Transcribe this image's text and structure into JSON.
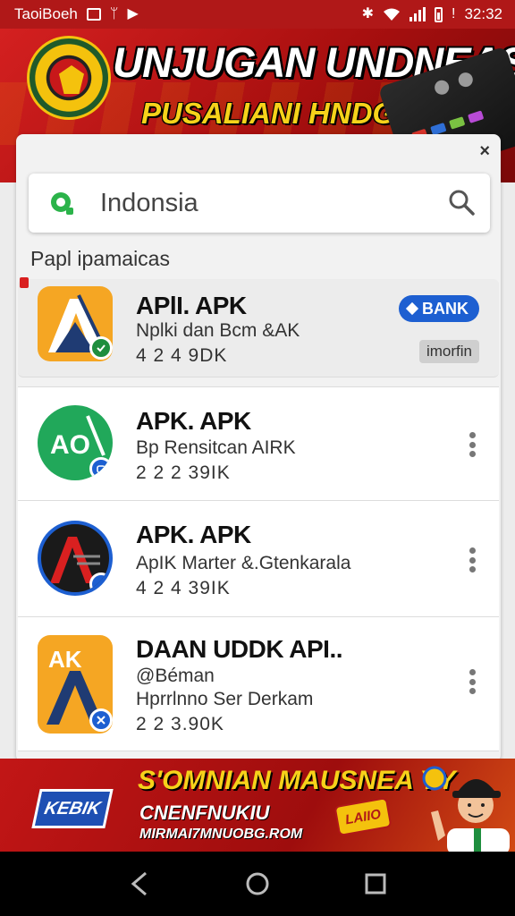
{
  "status_bar": {
    "carrier": "TaoiBoeh",
    "time": "32:32"
  },
  "top_banner": {
    "title": "UNJUGAN UNDNEASJA",
    "subtitle": "PUSALIANI HNDGAKII"
  },
  "search": {
    "close_label": "×",
    "query": "Indonsia"
  },
  "section": {
    "label": "Papl ipamaicas"
  },
  "results": [
    {
      "title": "APlI. APK",
      "subtitle": "Nplki dan Bcm &AK",
      "size": "4 2 4 9DK",
      "badge_label": "BANK",
      "tag_label": "imorfin",
      "featured": true,
      "icon_color": "#f5a623",
      "badge_color": "#1e8e3e"
    },
    {
      "title": "APK. APK",
      "subtitle": "Bp Rensitcan AIRK",
      "size": "2 2 2 39IK",
      "icon_color": "#21a85a",
      "badge_color": "#1d5fd1",
      "icon_text": "AO"
    },
    {
      "title": "APK. APK",
      "subtitle": "ApIK Marter &.Gtenkarala",
      "size": "4 2 4 39IK",
      "icon_color": "#1a1a1a",
      "badge_color": "#1d5fd1"
    },
    {
      "title": "DAAN UDDK API..",
      "handle": "@Béman",
      "subtitle": "Hprrlnno Ser Derkam",
      "size": "2 2 3.90K",
      "icon_color": "#f5a623",
      "badge_color": "#1d5fd1",
      "icon_text": "AK"
    }
  ],
  "bottom_banner": {
    "logo_text": "KEBIK",
    "title": "S'OMNIAN MAUSNEA YY",
    "subtitle": "CNENFNUKIU",
    "url": "MIRMAI7MNUOBG.ROM",
    "tag_text": "LAIIO"
  },
  "colors": {
    "brand_red": "#b01818",
    "accent_yellow": "#f6d21a",
    "chip_blue": "#1d5fd1"
  }
}
